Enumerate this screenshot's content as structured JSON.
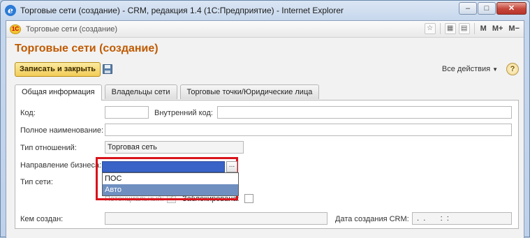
{
  "browser": {
    "title": "Торговые сети (создание) - CRM, редакция 1.4 (1С:Предприятие) - Internet Explorer",
    "logo_letter": "e",
    "btn_minimize": "–",
    "btn_maximize": "□",
    "btn_close": "✕"
  },
  "onec": {
    "logo_text": "1С",
    "window_title": "Торговые сети (создание)",
    "tools": {
      "m": "M",
      "m_plus": "M+",
      "m_minus": "M−"
    }
  },
  "form": {
    "title": "Торговые сети (создание)",
    "save_close_label": "Записать и закрыть",
    "all_actions_label": "Все действия",
    "help_label": "?"
  },
  "tabs": [
    "Общая информация",
    "Владельцы сети",
    "Торговые точки/Юридические лица"
  ],
  "fields": {
    "code_label": "Код:",
    "code_value": "",
    "internal_code_label": "Внутренний код:",
    "internal_code_value": "",
    "full_name_label": "Полное наименование:",
    "full_name_value": "",
    "relation_type_label": "Тип отношений:",
    "relation_type_value": "Торговая сеть",
    "business_direction_label": "Направление бизнеса:",
    "business_direction_options": [
      "ПОС",
      "Авто"
    ],
    "business_direction_selected": "Авто",
    "network_type_label": "Тип сети:",
    "potential_label": "Потенциальный:",
    "potential_checked": true,
    "blocked_label": "Заблокирована:",
    "blocked_checked": false,
    "created_by_label": "Кем создан:",
    "created_by_value": "",
    "crm_created_date_label": "Дата создания CRM:",
    "crm_created_date_value": " .  .       :  :"
  },
  "colors": {
    "title_orange": "#c05a00",
    "highlight_red": "#d8141b",
    "selection_blue": "#3a63c8"
  }
}
